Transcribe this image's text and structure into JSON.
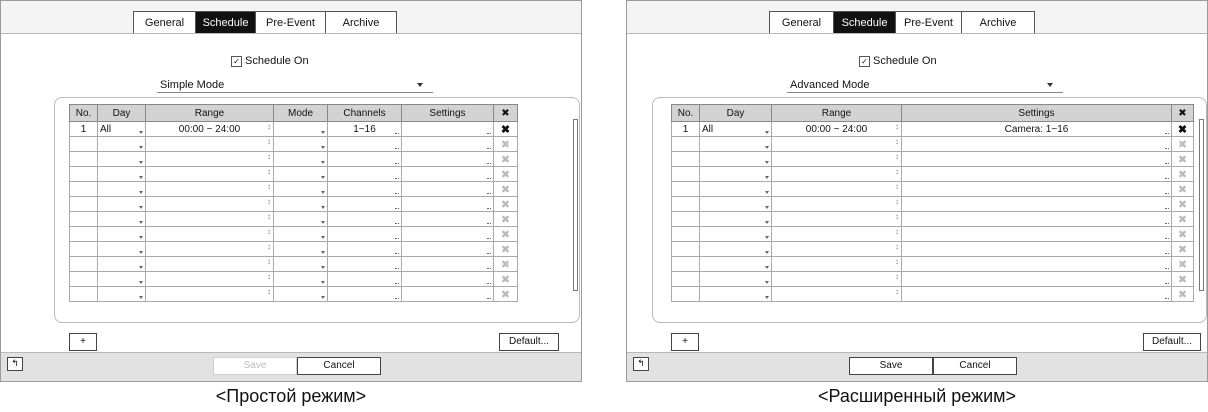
{
  "tabs": [
    "General",
    "Schedule",
    "Pre-Event",
    "Archive"
  ],
  "active_tab": "Schedule",
  "checkbox": {
    "label": "Schedule On",
    "checked": true
  },
  "left": {
    "mode": "Simple Mode",
    "headers": [
      "No.",
      "Day",
      "Range",
      "Mode",
      "Channels",
      "Settings"
    ],
    "row1": {
      "no": "1",
      "day": "All",
      "range": "00:00 ~ 24:00",
      "mode": "",
      "channels": "1~16",
      "settings": ""
    },
    "save_label": "Save",
    "save_enabled": false,
    "cancel_label": "Cancel",
    "caption": "<Простой режим>"
  },
  "right": {
    "mode": "Advanced Mode",
    "headers": [
      "No.",
      "Day",
      "Range",
      "Settings"
    ],
    "row1": {
      "no": "1",
      "day": "All",
      "range": "00:00 ~ 24:00",
      "settings": "Camera: 1~16"
    },
    "save_label": "Save",
    "save_enabled": true,
    "cancel_label": "Cancel",
    "caption": "<Расширенный режим>"
  },
  "icons": {
    "delete": "x-icon",
    "add": "plus-icon",
    "back": "back-arrow-icon"
  },
  "add_label": "+",
  "default_label": "Default...",
  "colors": {
    "tab_active_bg": "#111111",
    "header_bg": "#d3d3d3",
    "disabled_text": "#b9b9b9"
  }
}
